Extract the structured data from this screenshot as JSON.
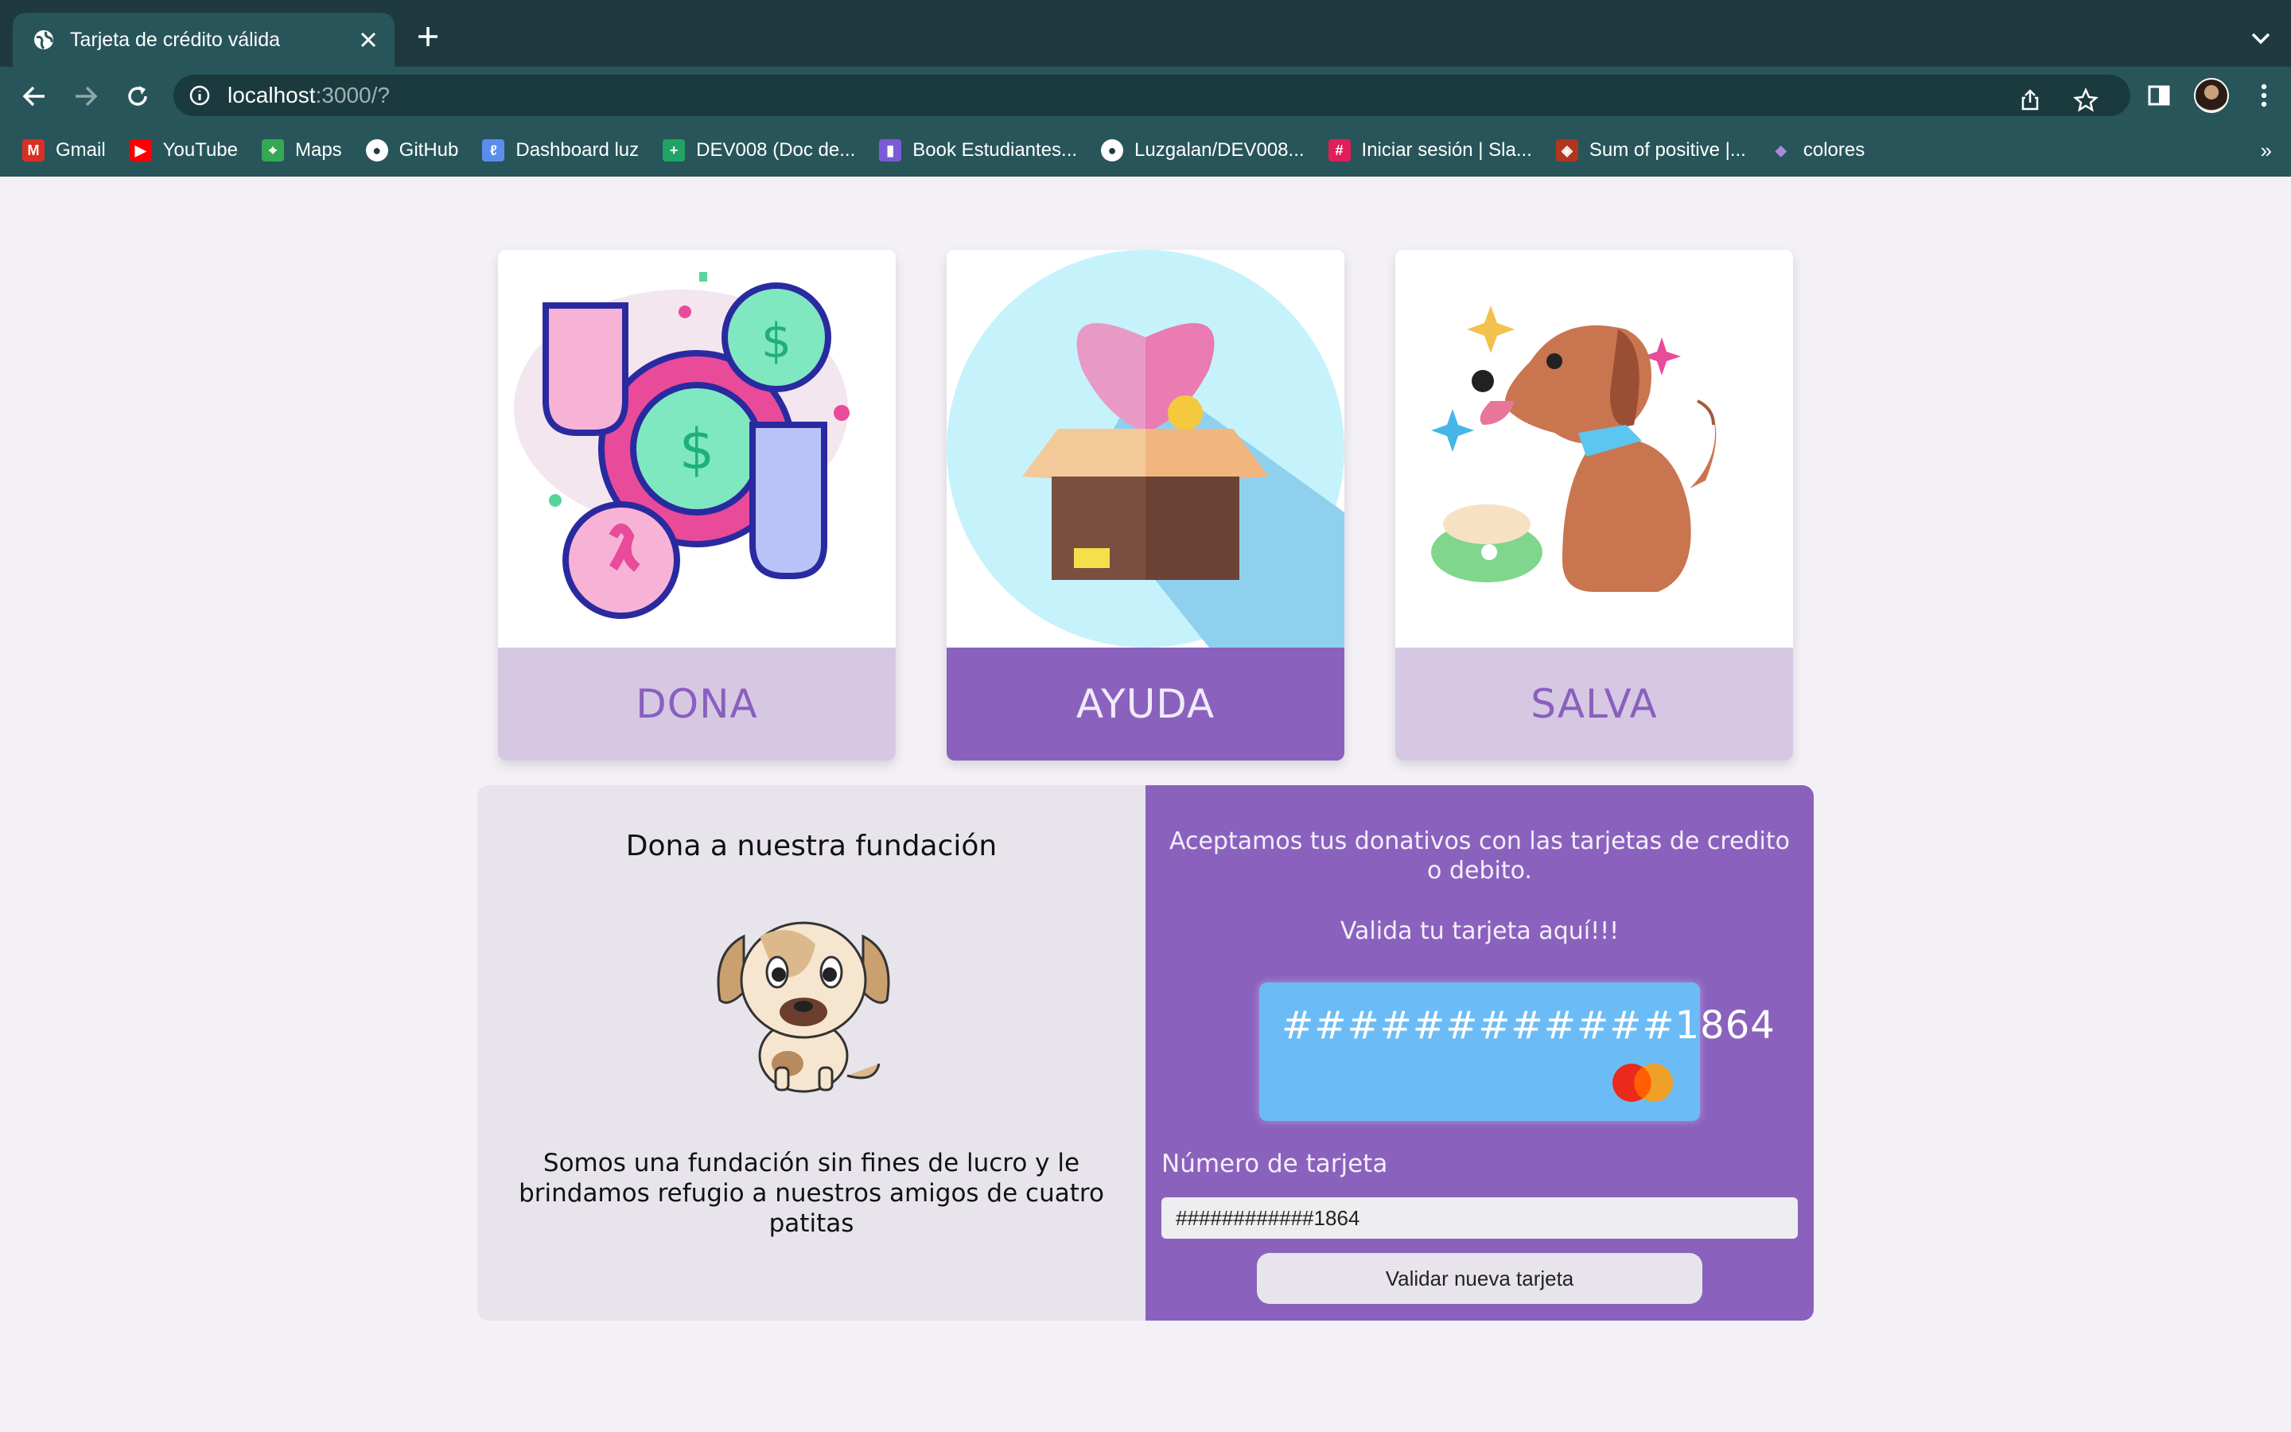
{
  "browser": {
    "tab_title": "Tarjeta de crédito válida",
    "url_host": "localhost",
    "url_path": ":3000/?",
    "bookmarks": [
      {
        "label": "Gmail",
        "icon": "gmail-icon",
        "color": "#d93025"
      },
      {
        "label": "YouTube",
        "icon": "youtube-icon",
        "color": "#ff0000"
      },
      {
        "label": "Maps",
        "icon": "maps-icon",
        "color": "#34a853"
      },
      {
        "label": "GitHub",
        "icon": "github-icon",
        "color": "#1e3a3f"
      },
      {
        "label": "Dashboard luz",
        "icon": "dashboard-icon",
        "color": "#5b8def"
      },
      {
        "label": "DEV008 (Doc de...",
        "icon": "sheets-icon",
        "color": "#1fa463"
      },
      {
        "label": "Book Estudiantes...",
        "icon": "book-icon",
        "color": "#7b5bd6"
      },
      {
        "label": "Luzgalan/DEV008...",
        "icon": "github-icon",
        "color": "#1e3a3f"
      },
      {
        "label": "Iniciar sesión | Sla...",
        "icon": "slack-icon",
        "color": "#e01e5a"
      },
      {
        "label": "Sum of positive |...",
        "icon": "codewars-icon",
        "color": "#b1361e"
      },
      {
        "label": "colores",
        "icon": "drop-icon",
        "color": "#a78bdb"
      }
    ]
  },
  "cards": [
    {
      "label": "DONA",
      "style": "light"
    },
    {
      "label": "AYUDA",
      "style": "dark"
    },
    {
      "label": "SALVA",
      "style": "light"
    }
  ],
  "left_panel": {
    "title": "Dona a nuestra fundación",
    "description": "Somos una fundación sin fines de lucro y le brindamos refugio a nuestros amigos de cuatro patitas"
  },
  "right_panel": {
    "accept_text": "Aceptamos tus donativos con las tarjetas de credito o debito.",
    "validate_text": "Valida tu tarjeta aquí!!!",
    "card_number_display": "############1864",
    "card_brand_icon": "mastercard-icon",
    "field_label": "Número de tarjeta",
    "field_value": "############1864",
    "button_label": "Validar nueva tarjeta"
  },
  "colors": {
    "brand_purple": "#8a62bd",
    "light_purple": "#d6c8e3",
    "card_blue": "#6bbcf6",
    "chrome_dark": "#1e3a3f",
    "chrome_mid": "#28555a"
  }
}
